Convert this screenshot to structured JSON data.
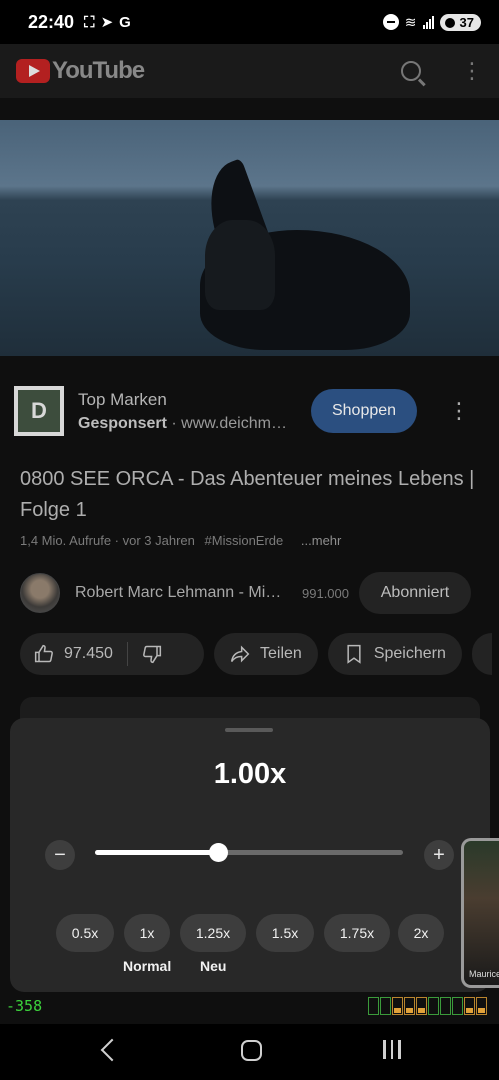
{
  "status_bar": {
    "time": "22:40",
    "notification_icons": [
      "screenshot-icon",
      "telegram-icon",
      "google-icon"
    ],
    "g_letter": "G",
    "battery": "37"
  },
  "app_bar": {
    "logo_text": "YouTube",
    "icons": [
      "search-icon",
      "more-vert-icon"
    ]
  },
  "ad": {
    "logo_letter": "D",
    "title": "Top Marken",
    "sponsored_label": "Gesponsert",
    "url": " · www.deichm…",
    "cta": "Shoppen"
  },
  "video": {
    "title": "0800 SEE ORCA - Das Abenteuer meines Lebens | Folge 1",
    "views": "1,4 Mio. Aufrufe",
    "age": " · vor 3 Jahren",
    "hashtag": "#MissionErde",
    "more": "...mehr"
  },
  "channel": {
    "name": "Robert Marc Lehmann - Mi…",
    "subscribers": "991.000",
    "subscribe_button": "Abonniert"
  },
  "actions": {
    "likes": "97.450",
    "share": "Teilen",
    "save": "Speichern"
  },
  "speed_sheet": {
    "current_value": "1.00x",
    "slider_fraction": 0.4,
    "minus": "−",
    "plus": "+",
    "presets": [
      {
        "label": "0.5x",
        "sublabel": ""
      },
      {
        "label": "1x",
        "sublabel": "Normal"
      },
      {
        "label": "1.25x",
        "sublabel": "Neu"
      },
      {
        "label": "1.5x",
        "sublabel": ""
      },
      {
        "label": "1.75x",
        "sublabel": ""
      },
      {
        "label": "2x",
        "sublabel": ""
      }
    ]
  },
  "mini_player": {
    "caption": "Maurice"
  },
  "debug": {
    "value": "-358"
  },
  "colors": {
    "accent_button": "#2b4f80",
    "sheet_bg": "#282828",
    "debug_green": "#3cd33c"
  }
}
